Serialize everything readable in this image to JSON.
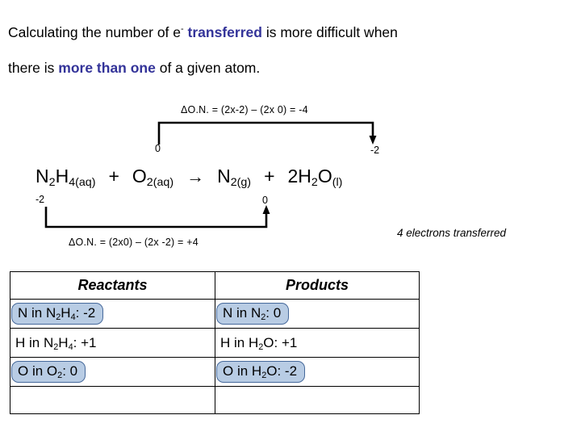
{
  "title": {
    "line1_part1": "Calculating the number of e",
    "line1_superscript": "-",
    "line1_highlight": "transferred",
    "line1_part2": "is more difficult when",
    "line2_part1": "there is",
    "line2_highlight": "more than one",
    "line2_part2": "of a given atom.",
    "highlight_color": "#333399"
  },
  "annotations": {
    "delta_top": "ΔO.N. = (2x-2) – (2x 0) = -4",
    "delta_bottom": "ΔO.N. = (2x0) – (2x -2) = +4",
    "electrons_transferred": "4 electrons transferred"
  },
  "oxidation_labels": {
    "top_left": "0",
    "top_right": "-2",
    "bottom_left": "-2",
    "bottom_right": "0"
  },
  "equation": {
    "reactant1_formula": "N",
    "reactant1_sub1": "2",
    "reactant1_el2": "H",
    "reactant1_sub2": "4",
    "reactant1_state": "(aq)",
    "plus1": "+",
    "reactant2_formula": "O",
    "reactant2_sub": "2",
    "reactant2_state": "(aq)",
    "arrow": "→",
    "product1_formula": "N",
    "product1_sub": "2",
    "product1_state": "(g)",
    "plus2": "+",
    "product2_coeff": "2",
    "product2_el1": "H",
    "product2_sub1": "2",
    "product2_el2": "O",
    "product2_state": "(l)"
  },
  "table": {
    "header_reactants": "Reactants",
    "header_products": "Products",
    "rows": [
      {
        "reactant_pre": "N in N",
        "reactant_sub1": "2",
        "reactant_mid": "H",
        "reactant_sub2": "4",
        "reactant_post": ": -2",
        "reactant_highlight": true,
        "product_pre": "N in N",
        "product_sub1": "2",
        "product_post": ": 0",
        "product_highlight": true
      },
      {
        "reactant_pre": "H in N",
        "reactant_sub1": "2",
        "reactant_mid": "H",
        "reactant_sub2": "4",
        "reactant_post": ": +1",
        "reactant_highlight": false,
        "product_pre": "H in H",
        "product_sub1": "2",
        "product_mid": "O",
        "product_post": ": +1",
        "product_highlight": false
      },
      {
        "reactant_pre": "O in O",
        "reactant_sub1": "2",
        "reactant_post": ": 0",
        "reactant_highlight": true,
        "product_pre": "O in H",
        "product_sub1": "2",
        "product_mid": "O",
        "product_post": ": -2",
        "product_highlight": true
      },
      {
        "reactant_pre": "",
        "product_pre": "",
        "reactant_highlight": false,
        "product_highlight": false
      }
    ],
    "highlight_fill": "#b8cce4",
    "highlight_border": "#46699b"
  }
}
